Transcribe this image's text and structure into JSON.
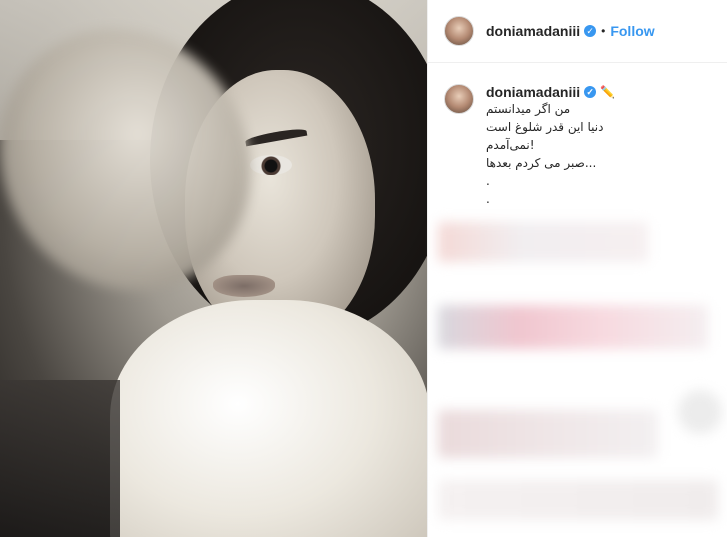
{
  "post": {
    "header": {
      "username": "doniamadaniii",
      "separator": "•",
      "follow_label": "Follow"
    },
    "caption": {
      "username": "doniamadaniii",
      "emoji": "✏️",
      "lines": [
        "من اگر میدانستم",
        "دنیا این قدر شلوغ است",
        "!نمی‌آمدم",
        "...صبر می کردم بعدها",
        ".",
        "."
      ]
    }
  }
}
